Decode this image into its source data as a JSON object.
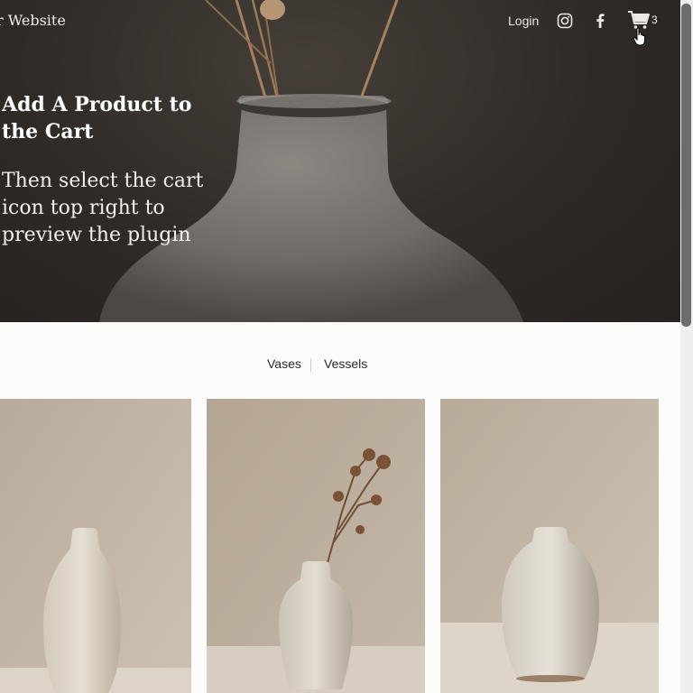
{
  "header": {
    "site_title": "r Website",
    "nav": {
      "login": "Login",
      "instagram_icon": "instagram-icon",
      "facebook_icon": "facebook-icon",
      "cart_icon": "cart-icon",
      "cart_count": "3"
    }
  },
  "hero": {
    "heading": "Add A Product to the Cart",
    "subtext": "Then select the cart icon top right to preview the plugin"
  },
  "categories": [
    "Vases",
    "Vessels"
  ],
  "products": [
    {
      "image": "cream-stoneware-vase"
    },
    {
      "image": "vase-with-dried-flowers"
    },
    {
      "image": "speckled-round-vase"
    }
  ],
  "colors": {
    "hero_background": "#2f2a26",
    "page_background": "#fbfbfa",
    "product_background": "#bfb2a2",
    "text_light": "#ffffff",
    "text_dark": "#2b2b2b"
  }
}
